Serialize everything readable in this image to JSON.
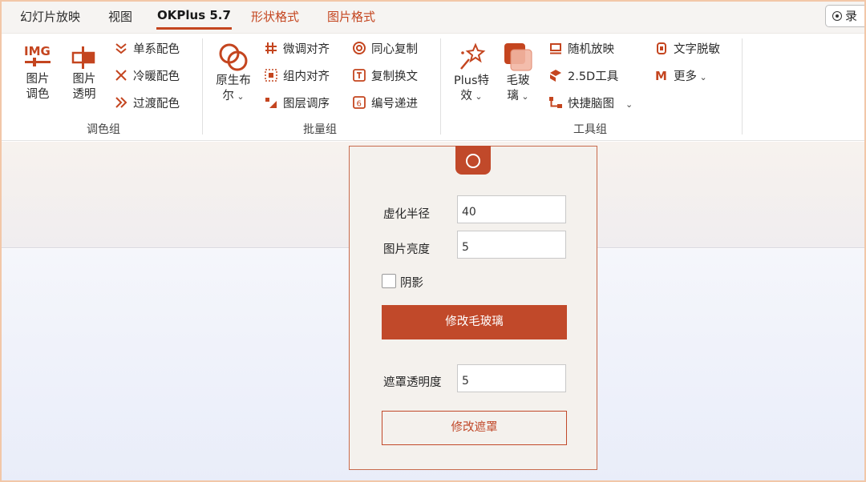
{
  "tabs": [
    {
      "label": "幻灯片放映"
    },
    {
      "label": "视图"
    },
    {
      "label": "OKPlus 5.7"
    },
    {
      "label": "形状格式"
    },
    {
      "label": "图片格式"
    }
  ],
  "record_button": {
    "label": "录"
  },
  "ribbon": {
    "color_group": {
      "label": "调色组",
      "image_tint": {
        "label": "图片\n调色",
        "icon_text": "IMG"
      },
      "image_transparency": {
        "label": "图片\n透明"
      },
      "mono_color": "单系配色",
      "warm_cool_color": "冷暖配色",
      "transition_color": "过渡配色"
    },
    "batch_group": {
      "label": "批量组",
      "native_boolean": {
        "label": "原生布\n尔"
      },
      "fine_align": "微调对齐",
      "group_align": "组内对齐",
      "layer_order": "图层调序",
      "concentric_copy": "同心复制",
      "copy_swap_text": "复制换文",
      "number_increment": "编号递进"
    },
    "tools_group": {
      "label": "工具组",
      "plus_effects": {
        "label": "Plus特\n效"
      },
      "frosted_glass": {
        "label": "毛玻\n璃"
      },
      "random_show": "随机放映",
      "tool_25d": "2.5D工具",
      "quick_mindmap": "快捷脑图",
      "text_mask": "文字脱敏",
      "more": "更多"
    }
  },
  "panel": {
    "blur_radius": {
      "label": "虚化半径",
      "value": "40"
    },
    "image_brightness": {
      "label": "图片亮度",
      "value": "5"
    },
    "shadow": {
      "label": "阴影",
      "checked": false
    },
    "apply_glass_button": "修改毛玻璃",
    "mask_opacity": {
      "label": "遮罩透明度",
      "value": "5"
    },
    "apply_mask_button": "修改遮罩"
  },
  "colors": {
    "accent": "#c1492a",
    "tab_red": "#c4451f"
  }
}
